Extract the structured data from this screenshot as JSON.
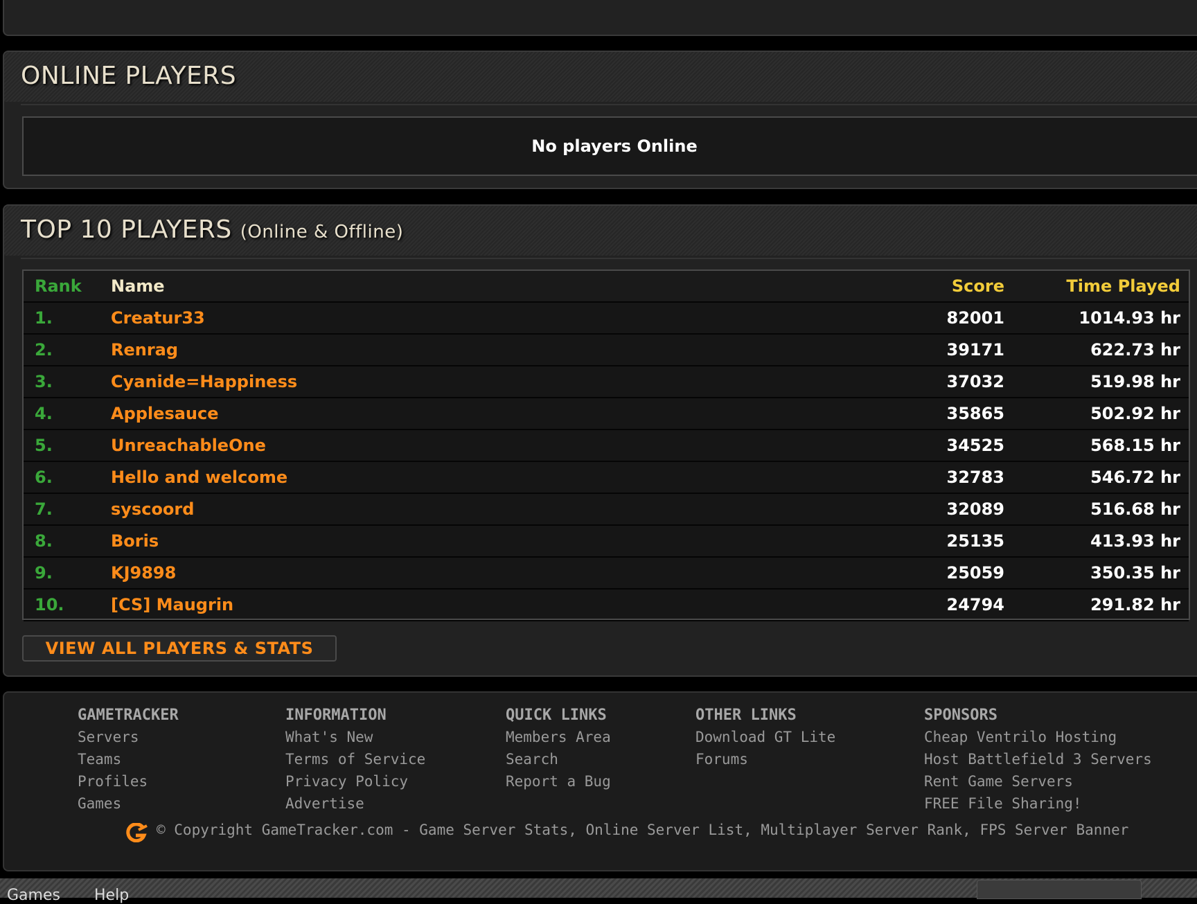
{
  "online_players": {
    "title": "ONLINE PLAYERS",
    "empty_message": "No players Online"
  },
  "top10": {
    "title": "TOP 10 PLAYERS",
    "subtitle": "(Online & Offline)",
    "headers": {
      "rank": "Rank",
      "name": "Name",
      "score": "Score",
      "time": "Time Played"
    },
    "rows": [
      {
        "rank": "1.",
        "name": "Creatur33",
        "score": "82001",
        "time": "1014.93 hr"
      },
      {
        "rank": "2.",
        "name": "Renrag",
        "score": "39171",
        "time": "622.73 hr"
      },
      {
        "rank": "3.",
        "name": "Cyanide=Happiness",
        "score": "37032",
        "time": "519.98 hr"
      },
      {
        "rank": "4.",
        "name": "Applesauce",
        "score": "35865",
        "time": "502.92 hr"
      },
      {
        "rank": "5.",
        "name": "UnreachableOne",
        "score": "34525",
        "time": "568.15 hr"
      },
      {
        "rank": "6.",
        "name": "Hello and welcome",
        "score": "32783",
        "time": "546.72 hr"
      },
      {
        "rank": "7.",
        "name": "syscoord",
        "score": "32089",
        "time": "516.68 hr"
      },
      {
        "rank": "8.",
        "name": "Boris",
        "score": "25135",
        "time": "413.93 hr"
      },
      {
        "rank": "9.",
        "name": "KJ9898",
        "score": "25059",
        "time": "350.35 hr"
      },
      {
        "rank": "10.",
        "name": "[CS] Maugrin",
        "score": "24794",
        "time": "291.82 hr"
      }
    ],
    "view_all_label": "VIEW ALL PLAYERS & STATS"
  },
  "footer": {
    "columns": [
      {
        "heading": "GAMETRACKER",
        "links": [
          "Servers",
          "Teams",
          "Profiles",
          "Games"
        ]
      },
      {
        "heading": "INFORMATION",
        "links": [
          "What's New",
          "Terms of Service",
          "Privacy Policy",
          "Advertise"
        ]
      },
      {
        "heading": "QUICK LINKS",
        "links": [
          "Members Area",
          "Search",
          "Report a Bug"
        ]
      },
      {
        "heading": "OTHER LINKS",
        "links": [
          "Download GT Lite",
          "Forums"
        ]
      },
      {
        "heading": "SPONSORS",
        "links": [
          "Cheap Ventrilo Hosting",
          "Host Battlefield 3 Servers",
          "Rent Game Servers",
          "FREE File Sharing!"
        ]
      }
    ],
    "copyright": "© Copyright GameTracker.com - Game Server Stats, Online Server List, Multiplayer Server Rank, FPS Server Banner"
  },
  "bottom_bar": {
    "link1": "Games",
    "link2": "Help"
  },
  "colors": {
    "rank_green": "#3aa83a",
    "name_orange": "#ff8c1a",
    "header_gold": "#f2cc3a",
    "panel_bg": "#222222"
  }
}
